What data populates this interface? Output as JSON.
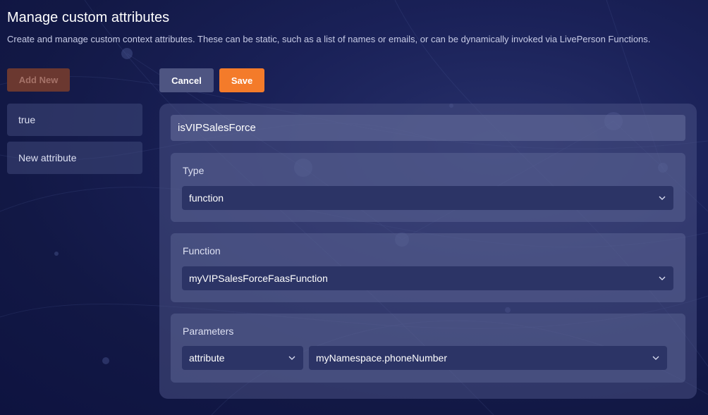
{
  "header": {
    "title": "Manage custom attributes",
    "subtitle": "Create and manage custom context attributes. These can be static, such as a list of names or emails, or can be dynamically invoked via LivePerson Functions."
  },
  "toolbar": {
    "add_new_label": "Add New",
    "cancel_label": "Cancel",
    "save_label": "Save"
  },
  "attributes_list": {
    "items": [
      {
        "label": "true"
      },
      {
        "label": "New attribute"
      }
    ]
  },
  "editor": {
    "name_value": "isVIPSalesForce",
    "type": {
      "label": "Type",
      "selected": "function"
    },
    "function": {
      "label": "Function",
      "selected": "myVIPSalesForceFaasFunction"
    },
    "parameters": {
      "label": "Parameters",
      "source_selected": "attribute",
      "value_selected": "myNamespace.phoneNumber"
    }
  },
  "colors": {
    "background": "#141a4a",
    "accent": "#f47b2a",
    "add_button": "#6b3830",
    "cancel_button": "#4e5582",
    "select_bg": "#2c3466"
  },
  "icons": {
    "dropdown": "chevron-down-icon"
  }
}
